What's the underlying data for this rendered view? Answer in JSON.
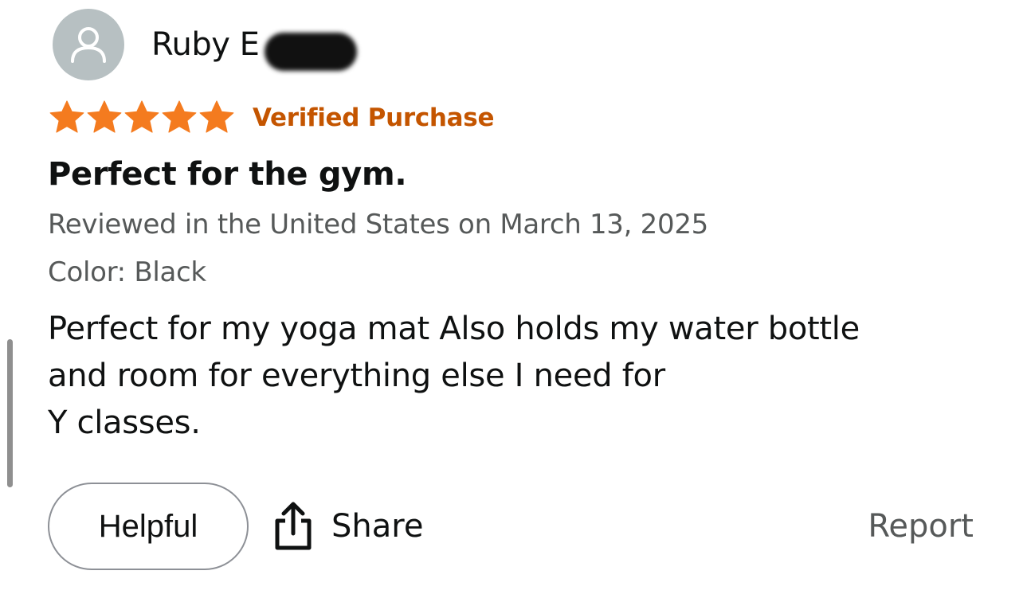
{
  "review": {
    "reviewer_name": "Ruby E",
    "rating": 5,
    "rating_max": 5,
    "badge": "Verified Purchase",
    "title": "Perfect for the gym.",
    "date_line": "Reviewed in the United States on March 13, 2025",
    "variant": "Color: Black",
    "body_lines": [
      "Perfect for my yoga mat Also holds my water bottle",
      "and room for everything else I need for",
      "Y classes."
    ]
  },
  "actions": {
    "helpful_label": "Helpful",
    "share_label": "Share",
    "report_label": "Report"
  },
  "colors": {
    "star": "#f47b1f",
    "badge": "#c45500",
    "meta_text": "#565959",
    "avatar_bg": "#b7c0c2"
  },
  "icons": {
    "avatar": "user-silhouette-icon",
    "star": "star-icon",
    "share": "share-upload-icon"
  }
}
